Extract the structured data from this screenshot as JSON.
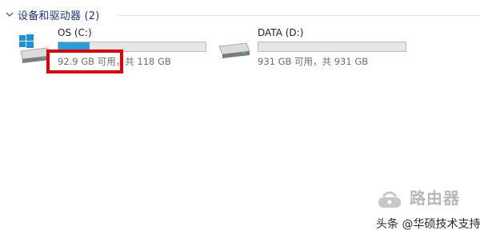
{
  "section": {
    "title": "设备和驱动器 (2)",
    "expand_icon": "chevron-down-icon"
  },
  "drives": [
    {
      "name": "OS (C:)",
      "icon": "windows-system-drive-icon",
      "used_fraction": 0.2127,
      "bar_color": "#26a0da",
      "free_text": "92.9 GB 可用",
      "total_text": "，共 118 GB"
    },
    {
      "name": "DATA (D:)",
      "icon": "hard-drive-icon",
      "used_fraction": 0.0,
      "bar_color": "#26a0da",
      "free_text": "931 GB 可用",
      "total_text": "，共 931 GB"
    }
  ],
  "annotation": {
    "color": "#e0000c"
  },
  "watermark": {
    "text": "路由器",
    "logo_icon": "router-logo-icon"
  },
  "source_credit": "头条 @华硕技术支持"
}
